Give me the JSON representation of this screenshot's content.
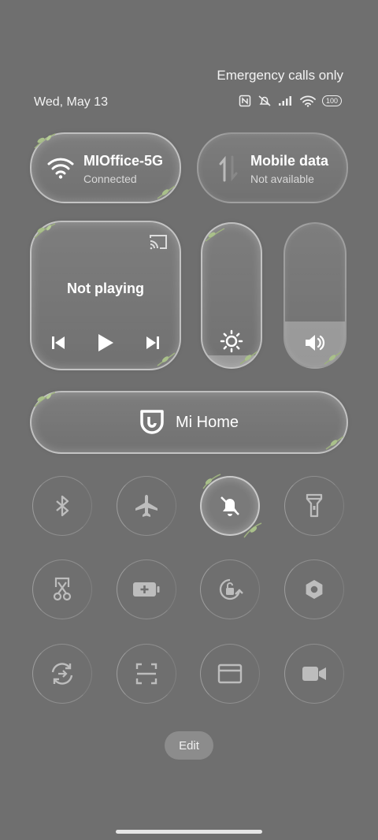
{
  "status": {
    "carrier_text": "Emergency calls only",
    "date": "Wed, May 13",
    "battery": "100"
  },
  "wifi_tile": {
    "title": "MIOffice-5G",
    "subtitle": "Connected"
  },
  "mobile_tile": {
    "title": "Mobile data",
    "subtitle": "Not available"
  },
  "media_tile": {
    "title": "Not playing"
  },
  "brightness": {
    "level": 0.08
  },
  "volume": {
    "level": 0.32
  },
  "mihome_tile": {
    "label": "Mi Home"
  },
  "toggles": [
    {
      "name": "bluetooth-icon",
      "state": "off"
    },
    {
      "name": "airplane-icon",
      "state": "off"
    },
    {
      "name": "mute-bell-icon",
      "state": "on"
    },
    {
      "name": "flashlight-icon",
      "state": "off"
    },
    {
      "name": "screenshot-scissor-icon",
      "state": "off"
    },
    {
      "name": "battery-saver-icon",
      "state": "off"
    },
    {
      "name": "rotation-lock-icon",
      "state": "off"
    },
    {
      "name": "settings-hexagon-icon",
      "state": "off"
    },
    {
      "name": "sync-icon",
      "state": "off"
    },
    {
      "name": "scanner-icon",
      "state": "off"
    },
    {
      "name": "card-icon",
      "state": "off"
    },
    {
      "name": "video-camera-icon",
      "state": "off"
    }
  ],
  "edit_button": {
    "label": "Edit"
  }
}
